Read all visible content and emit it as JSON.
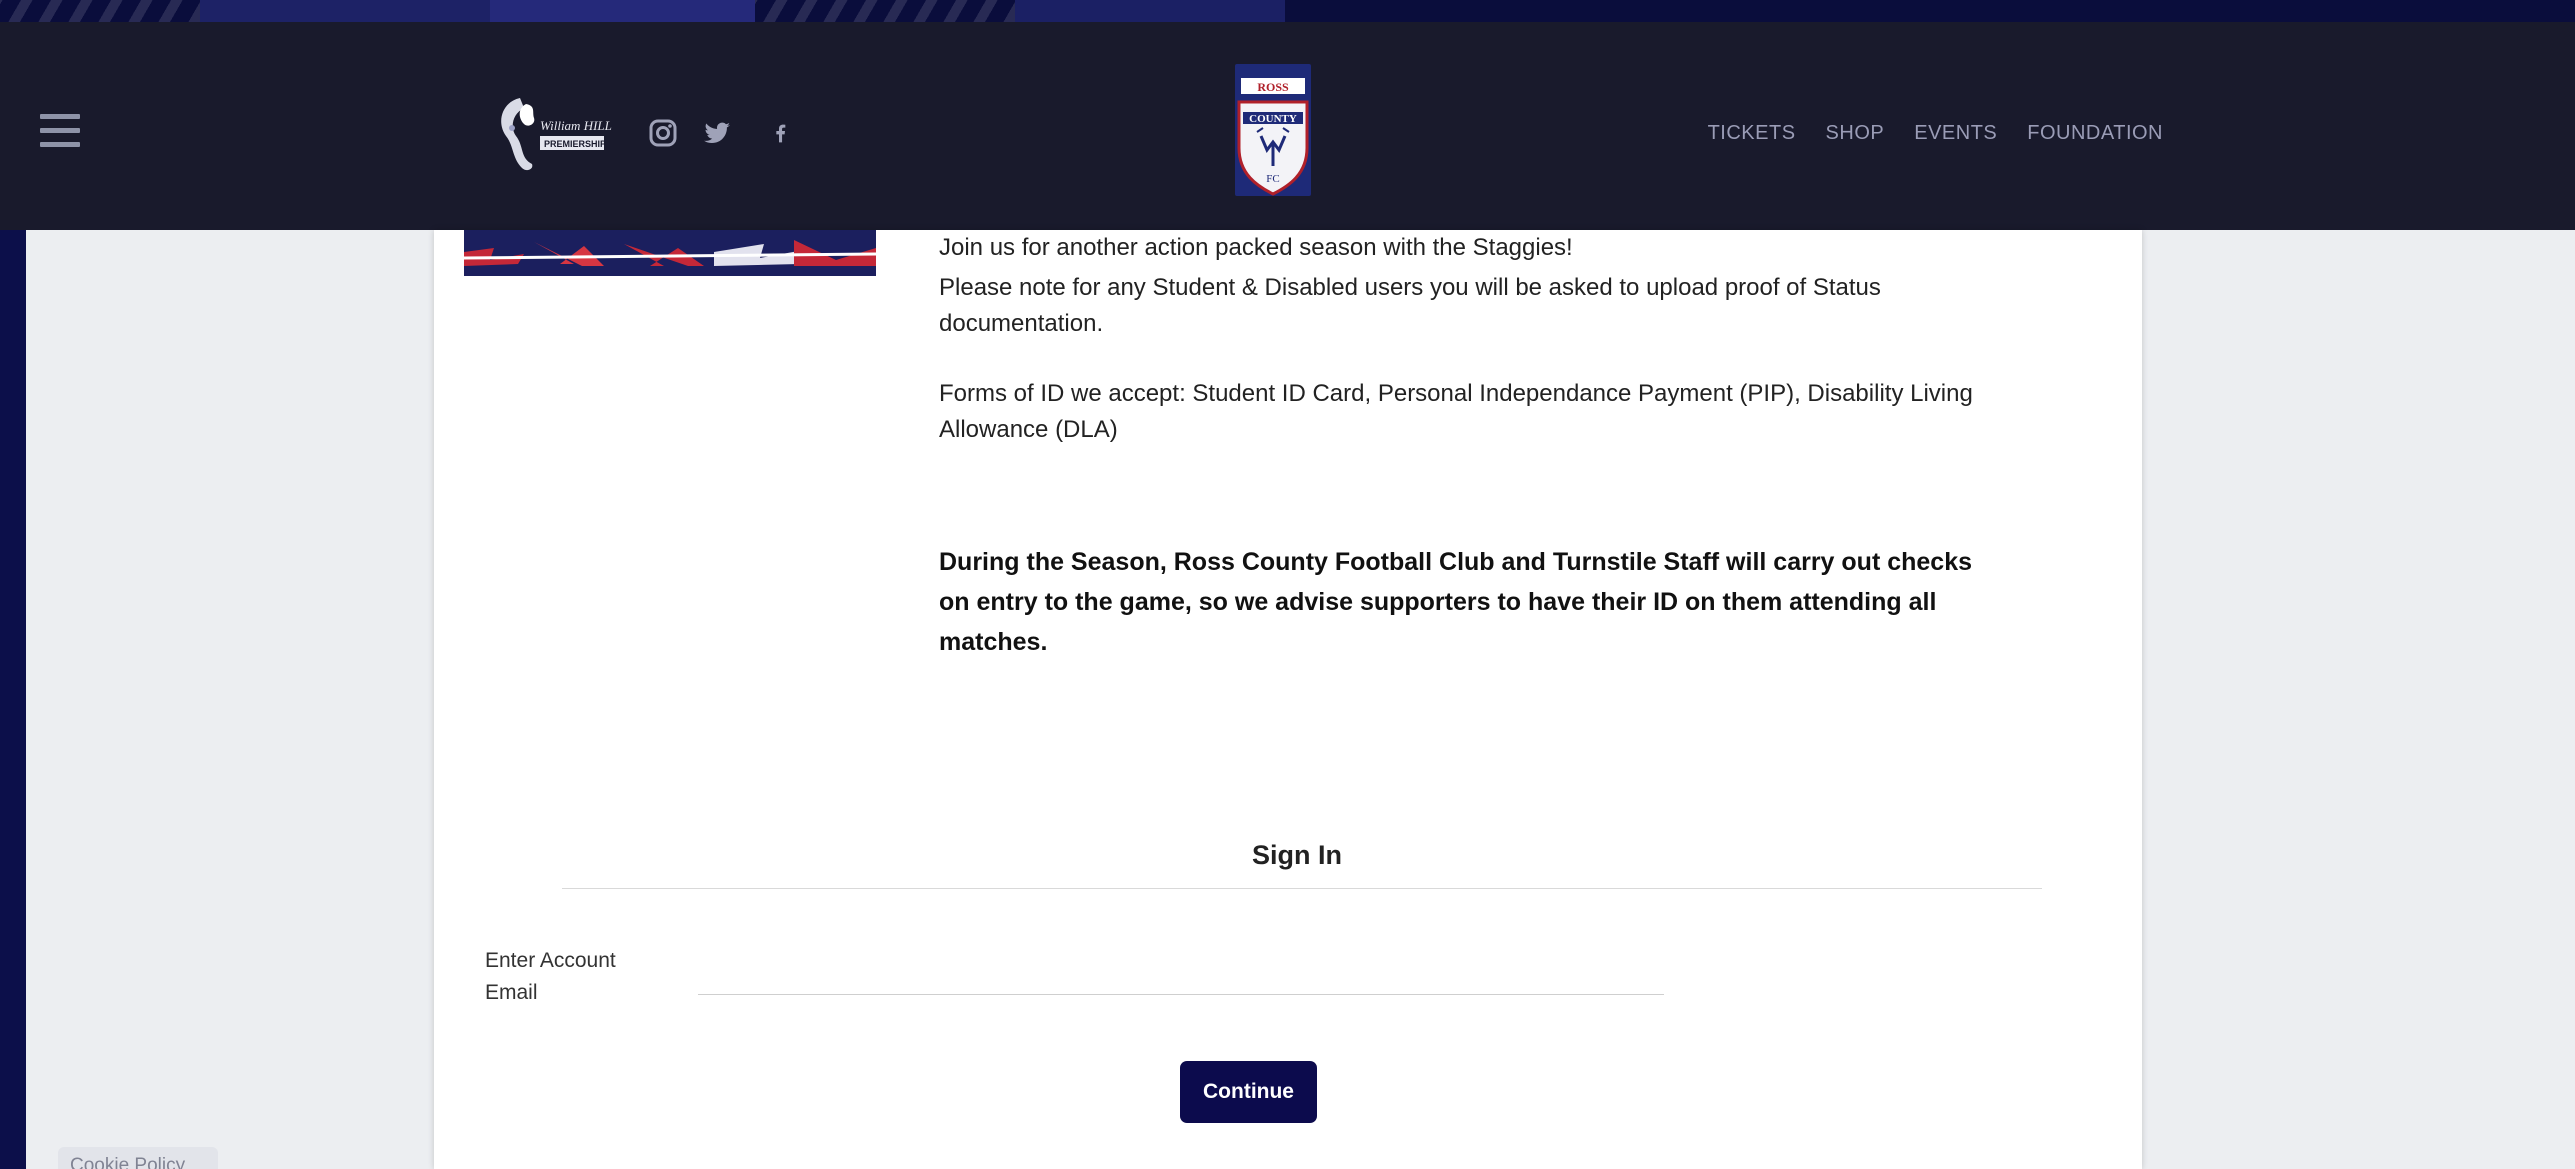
{
  "header": {
    "nav": [
      {
        "label": "TICKETS"
      },
      {
        "label": "SHOP"
      },
      {
        "label": "EVENTS"
      },
      {
        "label": "FOUNDATION"
      }
    ],
    "sponsor": {
      "line1": "William HILL",
      "line2": "PREMIERSHIP"
    },
    "crest": {
      "top": "ROSS",
      "middle": "COUNTY",
      "bottom": "FC"
    },
    "social_icons": [
      "instagram-icon",
      "twitter-icon",
      "facebook-icon"
    ],
    "colors": {
      "bar": "#191a2c",
      "nav_text": "#9a9cb6"
    }
  },
  "content": {
    "intro": "Join us for another action packed season with the Staggies!",
    "note": "Please note for any Student & Disabled users you will be asked to upload proof of Status documentation.",
    "forms_of_id": "Forms of ID we accept: Student ID Card, Personal Independance Payment (PIP), Disability Living Allowance (DLA)",
    "warning": "During the Season, Ross County Football Club and Turnstile Staff will carry out checks on entry to the game, so we advise supporters to have their ID on them attending all matches."
  },
  "sign_in": {
    "title": "Sign In",
    "email_label": "Enter Account Email",
    "email_value": "",
    "continue_label": "Continue",
    "button_color": "#0c0b4d"
  },
  "cookie_policy": "Cookie Policy"
}
